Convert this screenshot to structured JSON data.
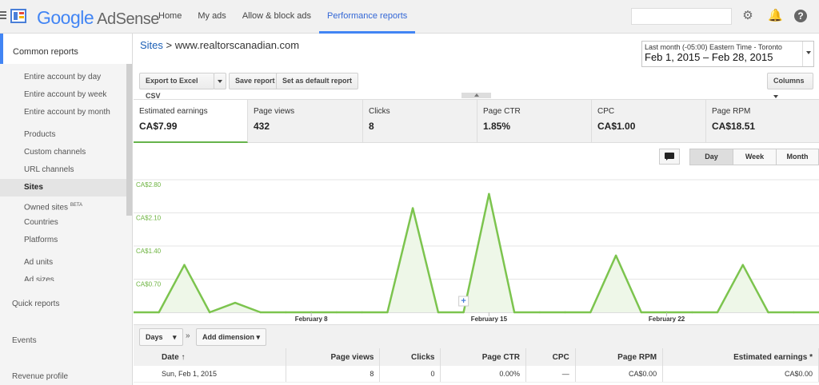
{
  "app": {
    "logo_google": "Google",
    "logo_product": "AdSense"
  },
  "topnav": {
    "tabs": [
      {
        "label": "Home",
        "active": false
      },
      {
        "label": "My ads",
        "active": false
      },
      {
        "label": "Allow & block ads",
        "active": false
      },
      {
        "label": "Performance reports",
        "active": true
      }
    ],
    "icons": [
      "gear-icon",
      "bell-icon",
      "help-icon"
    ]
  },
  "sidebar": {
    "common_reports": "Common reports",
    "items": [
      {
        "label": "Entire account by day"
      },
      {
        "label": "Entire account by week"
      },
      {
        "label": "Entire account by month"
      },
      {
        "label": "Products"
      },
      {
        "label": "Custom channels"
      },
      {
        "label": "URL channels"
      },
      {
        "label": "Sites",
        "active": true
      },
      {
        "label": "Owned sites",
        "badge": "BETA"
      },
      {
        "label": "Countries"
      },
      {
        "label": "Platforms"
      },
      {
        "label": "Ad units"
      },
      {
        "label": "Ad sizes"
      }
    ],
    "quick_reports": "Quick reports",
    "events": "Events",
    "revenue_profile": "Revenue profile"
  },
  "breadcrumb": {
    "root": "Sites",
    "separator": ">",
    "current": "www.realtorscanadian.com"
  },
  "date_picker": {
    "timezone": "Last month (-05:00) Eastern Time - Toronto",
    "range": "Feb 1, 2015 – Feb 28, 2015"
  },
  "toolbar": {
    "export": "Export to Excel CSV",
    "save": "Save report",
    "set_default": "Set as default report",
    "columns": "Columns"
  },
  "metrics": [
    {
      "label": "Estimated earnings",
      "value": "CA$7.99",
      "active": true
    },
    {
      "label": "Page views",
      "value": "432"
    },
    {
      "label": "Clicks",
      "value": "8"
    },
    {
      "label": "Page CTR",
      "value": "1.85%"
    },
    {
      "label": "CPC",
      "value": "CA$1.00"
    },
    {
      "label": "Page RPM",
      "value": "CA$18.51"
    }
  ],
  "granularity": {
    "day": "Day",
    "week": "Week",
    "month": "Month",
    "active": "Day"
  },
  "chart_data": {
    "type": "area",
    "y_ticks": [
      "CA$0.70",
      "CA$1.40",
      "CA$2.10",
      "CA$2.80"
    ],
    "x_ticks": [
      "February 8",
      "February 15",
      "February 22"
    ],
    "ylim": [
      0,
      2.8
    ],
    "series": [
      {
        "color": "#7cc44e",
        "values": [
          0,
          0,
          1,
          0,
          0.2,
          0,
          0,
          0,
          0,
          0,
          0,
          2.2,
          0,
          0,
          2.5,
          0,
          0,
          0,
          0,
          1.2,
          0,
          0,
          0,
          0,
          1.0,
          0,
          0,
          0
        ]
      }
    ]
  },
  "table_controls": {
    "days": "Days",
    "chevron": "»",
    "add_dimension": "Add dimension"
  },
  "table": {
    "columns": [
      "Date",
      "Page views",
      "Clicks",
      "Page CTR",
      "CPC",
      "Page RPM",
      "Estimated earnings *"
    ],
    "rows": [
      [
        "Sun, Feb 1, 2015",
        "8",
        "0",
        "0.00%",
        "—",
        "CA$0.00",
        "CA$0.00"
      ]
    ]
  }
}
